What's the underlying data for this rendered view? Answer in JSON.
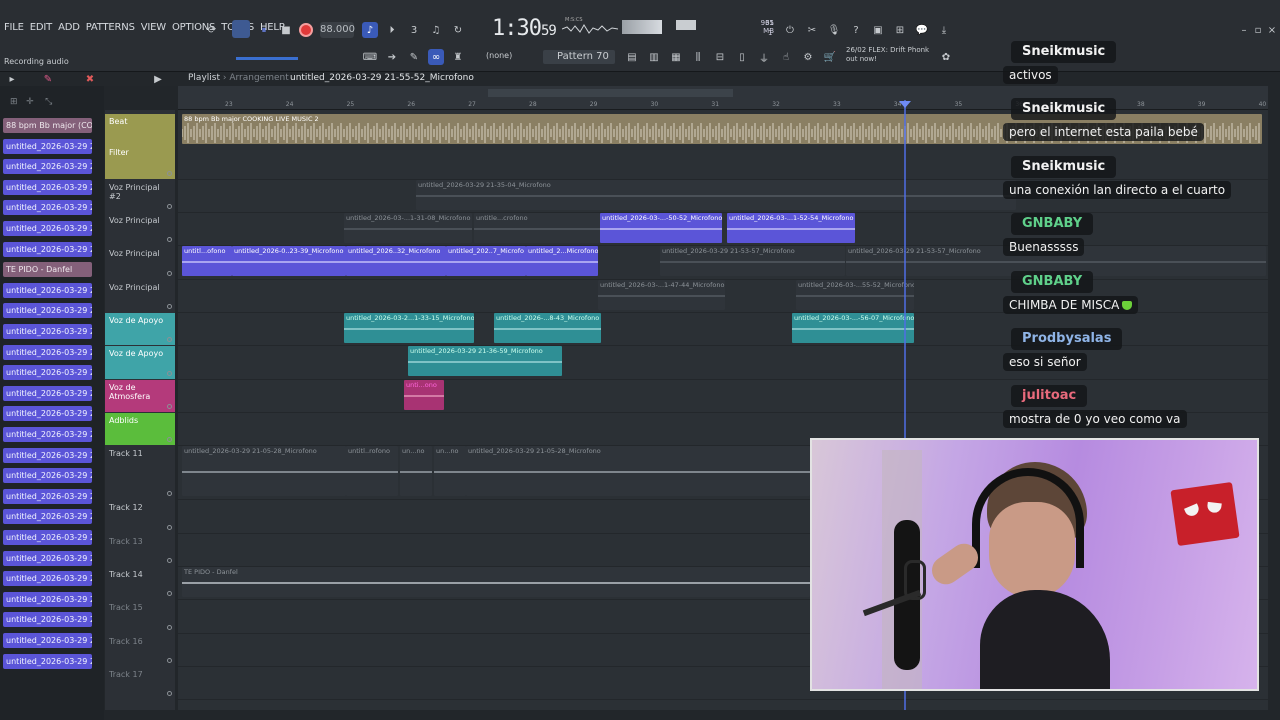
{
  "menu": [
    "FILE",
    "EDIT",
    "ADD",
    "PATTERNS",
    "VIEW",
    "OPTIONS",
    "TOOLS",
    "HELP"
  ],
  "status": "Recording audio",
  "transport": {
    "bpm": "88.000",
    "time_main": "1:30",
    "time_sub": "59",
    "time_units": "M:S:CS",
    "cpu_top": "35",
    "mem_top": "961 MB",
    "mem_sub": "1"
  },
  "toolbar": {
    "snap": "(none)",
    "pattern": "Pattern 70",
    "news_date": "26/02",
    "news_line1": "FLEX: Drift Phonk",
    "news_line2": "out now!"
  },
  "playlist": {
    "title": "Playlist",
    "view": "Arrangement",
    "current": "untitled_2026-03-29 21-55-52_Microfono"
  },
  "picker": [
    {
      "label": "88 bpm Bb major (CO...",
      "hl": true
    },
    {
      "label": "untitled_2026-03-29 20-...",
      "hl": false
    },
    {
      "label": "untitled_2026-03-29 20-...",
      "hl": false
    },
    {
      "label": "untitled_2026-03-29 20-...",
      "hl": false
    },
    {
      "label": "untitled_2026-03-29 20-...",
      "hl": false
    },
    {
      "label": "untitled_2026-03-29 20-...",
      "hl": false
    },
    {
      "label": "untitled_2026-03-29 20-...",
      "hl": false
    },
    {
      "label": "TE PIDO - Danfel",
      "hl": true
    },
    {
      "label": "untitled_2026-03-29 20-...",
      "hl": false
    },
    {
      "label": "untitled_2026-03-29 21-...",
      "hl": false
    },
    {
      "label": "untitled_2026-03-29 21-...",
      "hl": false
    },
    {
      "label": "untitled_2026-03-29 21-...",
      "hl": false
    },
    {
      "label": "untitled_2026-03-29 21-...",
      "hl": false
    },
    {
      "label": "untitled_2026-03-29 21-...",
      "hl": false
    },
    {
      "label": "untitled_2026-03-29 21-...",
      "hl": false
    },
    {
      "label": "untitled_2026-03-29 21-...",
      "hl": false
    },
    {
      "label": "untitled_2026-03-29 21-...",
      "hl": false
    },
    {
      "label": "untitled_2026-03-29 21-...",
      "hl": false
    },
    {
      "label": "untitled_2026-03-29 21-...",
      "hl": false
    },
    {
      "label": "untitled_2026-03-29 21-...",
      "hl": false
    },
    {
      "label": "untitled_2026-03-29 21-...",
      "hl": false
    },
    {
      "label": "untitled_2026-03-29 21-...",
      "hl": false
    },
    {
      "label": "untitled_2026-03-29 21-...",
      "hl": false
    },
    {
      "label": "untitled_2026-03-29 21-...",
      "hl": false
    },
    {
      "label": "untitled_2026-03-29 21-...",
      "hl": false
    },
    {
      "label": "untitled_2026-03-29 21-...",
      "hl": false
    },
    {
      "label": "untitled_2026-03-29 21-...",
      "hl": false
    }
  ],
  "ruler": [
    "23",
    "24",
    "25",
    "26",
    "27",
    "28",
    "29",
    "30",
    "31",
    "32",
    "33",
    "34",
    "35",
    "36",
    "37",
    "38",
    "39",
    "40"
  ],
  "tracks": [
    {
      "name": "Beat",
      "sub": "Filter",
      "color": "#9a9a50"
    },
    {
      "name": "Voz Principal #2",
      "sub": "",
      "color": ""
    },
    {
      "name": "Voz Principal",
      "sub": "",
      "color": ""
    },
    {
      "name": "Voz Principal",
      "sub": "",
      "color": ""
    },
    {
      "name": "Voz Principal",
      "sub": "",
      "color": ""
    },
    {
      "name": "Voz de Apoyo",
      "sub": "",
      "color": "#3fa4a8"
    },
    {
      "name": "Voz de Apoyo",
      "sub": "",
      "color": "#3fa4a8"
    },
    {
      "name": "Voz de Atmosfera",
      "sub": "",
      "color": "#b43a7b"
    },
    {
      "name": "Adblids",
      "sub": "",
      "color": "#5bbd3c"
    },
    {
      "name": "Track 11",
      "sub": "",
      "color": ""
    },
    {
      "name": "Track 12",
      "sub": "",
      "color": ""
    },
    {
      "name": "Track 13",
      "sub": "",
      "color": ""
    },
    {
      "name": "Track 14",
      "sub": "",
      "color": ""
    },
    {
      "name": "Track 15",
      "sub": "",
      "color": ""
    },
    {
      "name": "Track 16",
      "sub": "",
      "color": ""
    },
    {
      "name": "Track 17",
      "sub": "",
      "color": ""
    }
  ],
  "clips": {
    "beat": "88 bpm Bb major COOKING LIVE MUSIC 2",
    "vp2": "untitled_2026-03-29 21-35-04_Microfono",
    "vp_a": "untitled_2026-03-...1-31-08_Microfono",
    "vp_b": "untitle...crofono",
    "vp_c": "untitled_2026-03-...-50-52_Microfono",
    "vp_d": "untitled_2026-03-...1-52-54_Microfono",
    "vp2_a": "untitl...ofono",
    "vp2_b": "untitled_2026-0..23-39_Microfono",
    "vp2_c": "untitled_2026..32_Microfono",
    "vp2_d": "untitled_202..7_Microfo",
    "vp2_e": "untitled_2...Microfono",
    "vp2_f": "untitled_2026-03-29 21-53-57_Microfono",
    "vp2_g": "untitled_2026-03-29 21-53-57_Microfono",
    "vp3_a": "untitled_2026-03-...1-47-44_Microfono",
    "vp3_b": "untitled_2026-03-...55-52_Microfono",
    "ap_a": "untitled_2026-03-2...1-33-15_Microfono",
    "ap_b": "untitled_2026-...8-43_Microfono",
    "ap_c": "untitled_2026-03-...-56-07_Microfono",
    "ap2_a": "untitled_2026-03-29 21-36-59_Microfono",
    "atm_a": "unti...ono",
    "t11_a": "untitled_2026-03-29 21-05-28_Microfono",
    "t11_b": "untitl..rofono",
    "t11_c": "un...no",
    "t11_d": "un...no",
    "t11_e": "untitled_2026-03-29 21-05-28_Microfono",
    "t14_a": "TE PIDO - Danfel"
  },
  "chat": [
    {
      "user": "Sneikmusic",
      "color": "#f1f1f1",
      "text": "activos",
      "heart": false
    },
    {
      "user": "Sneikmusic",
      "color": "#f1f1f1",
      "text": "pero el internet esta paila bebé",
      "heart": false
    },
    {
      "user": "Sneikmusic",
      "color": "#f1f1f1",
      "text": "una conexión lan directo a el cuarto",
      "heart": false
    },
    {
      "user": "GNBABY",
      "color": "#5fd08a",
      "text": "Buenasssss",
      "heart": false
    },
    {
      "user": "GNBABY",
      "color": "#5fd08a",
      "text": "CHIMBA DE MISCA",
      "heart": true
    },
    {
      "user": "Prodbysalas",
      "color": "#8fb4e6",
      "text": "eso si señor",
      "heart": false
    },
    {
      "user": "julitoac",
      "color": "#e86a7c",
      "text": "mostra de 0 yo veo como va",
      "heart": false
    }
  ]
}
